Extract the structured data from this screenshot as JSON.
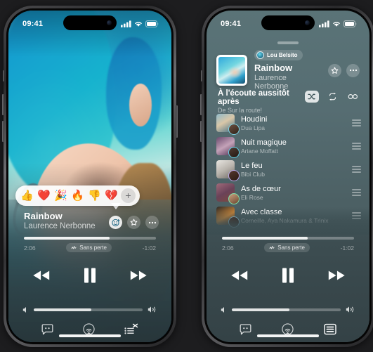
{
  "meta": {
    "bg_color": "#1d1d1f"
  },
  "left_phone": {
    "status_bar": {
      "time": "09:41",
      "cellular": "cellular-icon",
      "wifi": "wifi-icon",
      "battery": "battery-icon"
    },
    "reactions": {
      "emojis": [
        "👍",
        "❤️",
        "🎉",
        "🔥",
        "👎",
        "💔"
      ],
      "add_label": "+"
    },
    "now_playing": {
      "title": "Rainbow",
      "artist": "Laurence Nerbonne",
      "actions": [
        {
          "name": "reaction-button",
          "icon": "smiley-plus-icon",
          "active": true
        },
        {
          "name": "star-button",
          "icon": "star-icon",
          "active": false
        },
        {
          "name": "more-button",
          "icon": "ellipsis-icon",
          "active": false
        }
      ]
    },
    "progress": {
      "elapsed": "2:06",
      "remaining": "-1:02",
      "percent": 65,
      "quality_badge": "Sans perte"
    },
    "transport": {
      "rewind": "rewind-icon",
      "playpause": "pause-icon",
      "forward": "fast-forward-icon"
    },
    "volume": {
      "percent": 53,
      "low_icon": "volume-low-icon",
      "high_icon": "volume-high-icon"
    },
    "bottom_bar": [
      {
        "name": "lyrics-button",
        "icon": "lyrics-icon",
        "active": false
      },
      {
        "name": "airplay-button",
        "icon": "airplay-icon",
        "active": false
      },
      {
        "name": "queue-button",
        "icon": "queue-shuffle-icon",
        "active": false
      }
    ]
  },
  "right_phone": {
    "status_bar": {
      "time": "09:41",
      "cellular": "cellular-icon",
      "wifi": "wifi-icon",
      "battery": "battery-icon"
    },
    "now_playing": {
      "owner": "Lou Belsito",
      "title": "Rainbow",
      "artist": "Laurence Nerbonne",
      "actions": [
        {
          "name": "star-button",
          "icon": "star-icon"
        },
        {
          "name": "more-button",
          "icon": "ellipsis-icon"
        }
      ]
    },
    "up_next": {
      "title": "À l'écoute aussitôt après",
      "subtitle": "De Sur la route!",
      "controls": [
        {
          "name": "shuffle-button",
          "icon": "shuffle-icon",
          "active": true
        },
        {
          "name": "repeat-button",
          "icon": "repeat-icon",
          "active": false
        },
        {
          "name": "autoplay-button",
          "icon": "infinity-icon",
          "active": false
        }
      ]
    },
    "queue": [
      {
        "title": "Houdini",
        "artist": "Dua Lipa",
        "art": "linear-gradient(150deg,#8fb9c9,#d9c7a8 45%,#3f6d84)",
        "ring": "#7fd6e8",
        "avatar": "linear-gradient(150deg,#6b5040,#32231a)"
      },
      {
        "title": "Nuit magique",
        "artist": "Ariane Moffatt",
        "art": "linear-gradient(150deg,#6b4b6e,#c4a2b8 50%,#4a2f52)",
        "ring": "#63d2ea",
        "avatar": "linear-gradient(150deg,#4f3b32,#241812)"
      },
      {
        "title": "Le feu",
        "artist": "Bibi Club",
        "art": "linear-gradient(150deg,#e8e6e1,#b9b4ad 50%,#6f6a64)",
        "ring": "#b9a6ea",
        "avatar": "linear-gradient(150deg,#55372c,#2a1a14)"
      },
      {
        "title": "As de cœur",
        "artist": "Eli Rose",
        "art": "linear-gradient(150deg,#a06a7a,#6a4258 50%,#7d4a3e)",
        "ring": "#7fe0a8",
        "avatar": "linear-gradient(150deg,#caa27f,#6b4630)"
      },
      {
        "title": "Avec classe",
        "artist": "Corneille, Aya Nakamura & Trinix",
        "art": "linear-gradient(150deg,#2c2a28,#c08038 55%,#3a3330)",
        "ring": "#8fc8e0",
        "avatar": "linear-gradient(150deg,#4a3128,#1e120d)"
      }
    ],
    "progress": {
      "elapsed": "2:06",
      "remaining": "-1:02",
      "percent": 65,
      "quality_badge": "Sans perte"
    },
    "transport": {
      "rewind": "rewind-icon",
      "playpause": "pause-icon",
      "forward": "fast-forward-icon"
    },
    "volume": {
      "percent": 53,
      "low_icon": "volume-low-icon",
      "high_icon": "volume-high-icon"
    },
    "bottom_bar": [
      {
        "name": "lyrics-button",
        "icon": "lyrics-icon",
        "active": false
      },
      {
        "name": "airplay-button",
        "icon": "airplay-icon",
        "active": false
      },
      {
        "name": "queue-button",
        "icon": "queue-list-icon",
        "active": true
      }
    ]
  }
}
